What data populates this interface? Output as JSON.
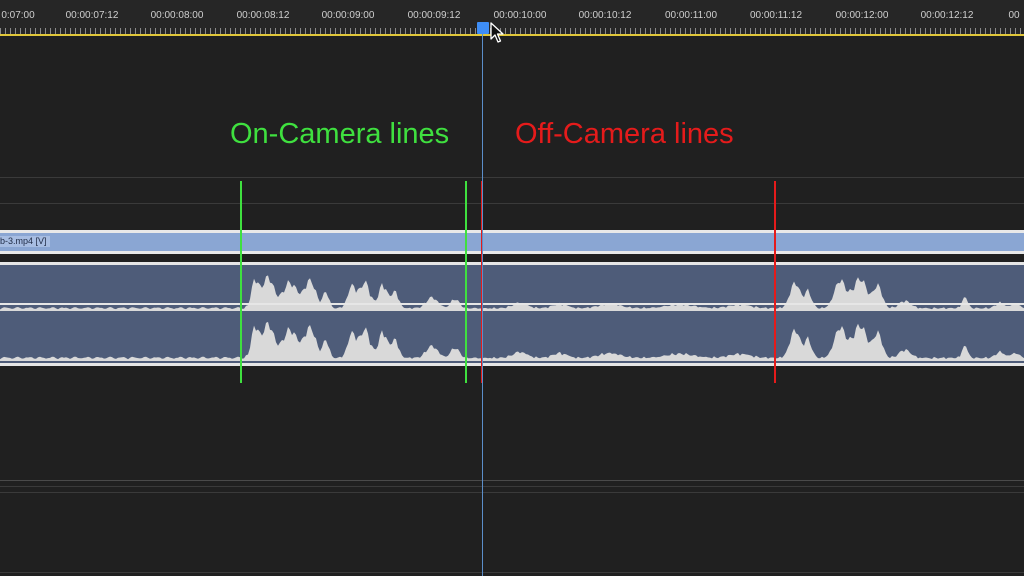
{
  "timeline": {
    "ruler_labels": [
      "0:07:00",
      "00:00:07:12",
      "00:00:08:00",
      "00:00:08:12",
      "00:00:09:00",
      "00:00:09:12",
      "00:00:10:00",
      "00:00:10:12",
      "00:00:11:00",
      "00:00:11:12",
      "00:00:12:00",
      "00:00:12:12",
      "00"
    ],
    "video_clip_label": "b-3.mp4 [V]",
    "colors": {
      "work_area_bar": "#e1c73a",
      "playhead": "#3e8ef7",
      "video_clip": "#8aa6d3",
      "audio_clip": "#4e5c79",
      "waveform": "#d9d9d9"
    }
  },
  "annotations": {
    "on_camera_label": "On-Camera lines",
    "off_camera_label": "Off-Camera lines",
    "on_camera_color": "#3fe03f",
    "off_camera_color": "#e51b1b"
  }
}
